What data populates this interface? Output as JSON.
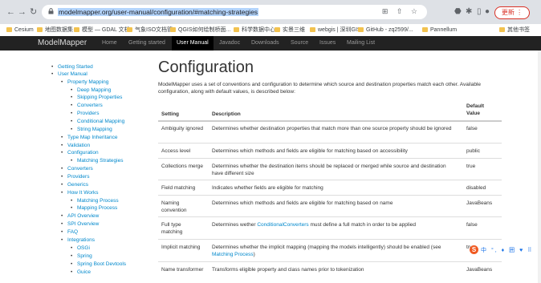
{
  "browser": {
    "url_plain": "modelmapper.org/user-manual/configuration/#matching-strategies",
    "update_label": "更新 ⋮",
    "bookmarks": [
      "Cesium",
      "地图数据集",
      "模型 — GDAL 文档",
      "气象ISO文档管",
      "QGIS如何绘制桥面...",
      "科学数据中心",
      "实景三维",
      "webgis | 深圳GIS",
      "GitHub - zq2599/...",
      "Pannellum",
      "其他书签"
    ]
  },
  "site": {
    "brand": "ModelMapper",
    "nav": [
      "Home",
      "Getting started",
      "User Manual",
      "Javadoc",
      "Downloads",
      "Source",
      "Issues",
      "Mailing List"
    ]
  },
  "sidebar": {
    "items": [
      {
        "label": "Getting Started"
      },
      {
        "label": "User Manual"
      },
      {
        "label": "Property Mapping"
      },
      {
        "label": "Deep Mapping"
      },
      {
        "label": "Skipping Properties"
      },
      {
        "label": "Converters"
      },
      {
        "label": "Providers"
      },
      {
        "label": "Conditional Mapping"
      },
      {
        "label": "String Mapping"
      },
      {
        "label": "Type Map Inheritance"
      },
      {
        "label": "Validation"
      },
      {
        "label": "Configuration"
      },
      {
        "label": "Matching Strategies"
      },
      {
        "label": "Converters"
      },
      {
        "label": "Providers"
      },
      {
        "label": "Generics"
      },
      {
        "label": "How It Works"
      },
      {
        "label": "Matching Process"
      },
      {
        "label": "Mapping Process"
      },
      {
        "label": "API Overview"
      },
      {
        "label": "SPI Overview"
      },
      {
        "label": "FAQ"
      },
      {
        "label": "Integrations"
      },
      {
        "label": "OSGi"
      },
      {
        "label": "Spring"
      },
      {
        "label": "Spring Boot Devtools"
      },
      {
        "label": "Guice"
      }
    ]
  },
  "main": {
    "title": "Configuration",
    "intro": "ModelMapper uses a set of conventions and configuration to determine which source and destination properties match each other. Available configuration, along with default values, is described below:",
    "headers": {
      "setting": "Setting",
      "description": "Description",
      "default_1": "Default",
      "default_2": "Value"
    },
    "rows": [
      {
        "setting": "Ambiguity ignored",
        "description": "Determines whether destination properties that match more than one source property should be ignored",
        "default": "false"
      },
      {
        "setting": "Access level",
        "description": "Determines which methods and fields are eligible for matching based on accessibility",
        "default": "public"
      },
      {
        "setting": "Collections merge",
        "description": "Determines whether the destination items should be replaced or merged while source and destination have different size",
        "default": "true"
      },
      {
        "setting": "Field matching",
        "description": "Indicates whether fields are eligible for matching",
        "default": "disabled"
      },
      {
        "setting": "Naming convention",
        "description": "Determines which methods and fields are eligible for matching based on name",
        "default": "JavaBeans"
      },
      {
        "setting": "Full type matching",
        "description_pre": "Determines wether ",
        "description_link": "ConditionalConverters",
        "description_post": " must define a full match in order to be applied",
        "default": "false"
      },
      {
        "setting": "Implicit matching",
        "description_pre": "Determines whether the implicit mapping (mapping the models intelligently) should be enabled (see ",
        "description_link": "Matching Process",
        "description_post": ")",
        "default": "true"
      },
      {
        "setting": "Name transformer",
        "description": "Transforms eligible property and class names prior to tokenization",
        "default": "JavaBeans"
      }
    ]
  },
  "ime": {
    "logo": "S",
    "rest": "中 °, ♦ 囲 ♥ ⠿"
  }
}
